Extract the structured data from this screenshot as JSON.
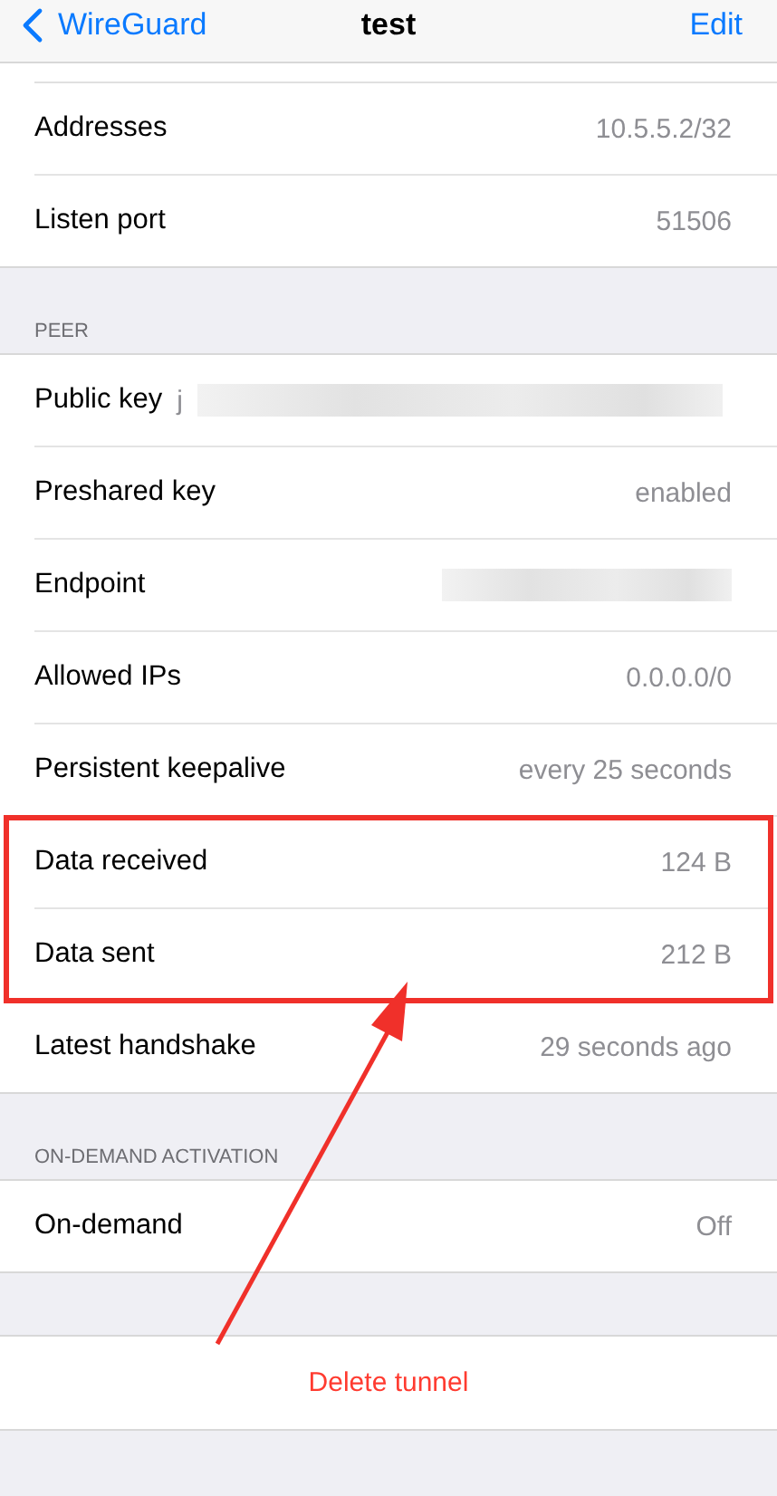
{
  "nav": {
    "back": "WireGuard",
    "title": "test",
    "action": "Edit"
  },
  "interface_rows": [
    {
      "label": "Addresses",
      "kind": "text",
      "value": "10.5.5.2/32",
      "highlighted": false
    },
    {
      "label": "Listen port",
      "kind": "text",
      "value": "51506",
      "highlighted": false
    }
  ],
  "peer": {
    "header": "PEER",
    "rows": [
      {
        "label": "Public key",
        "kind": "redacted",
        "value": "j",
        "highlighted": false
      },
      {
        "label": "Preshared key",
        "kind": "text",
        "value": "enabled",
        "highlighted": false
      },
      {
        "label": "Endpoint",
        "kind": "redacted",
        "highlighted": false
      },
      {
        "label": "Allowed IPs",
        "kind": "text",
        "value": "0.0.0.0/0",
        "highlighted": false
      },
      {
        "label": "Persistent keepalive",
        "kind": "text",
        "value": "every 25 seconds",
        "highlighted": false
      },
      {
        "label": "Data received",
        "kind": "text",
        "value": "124 B",
        "highlighted": true
      },
      {
        "label": "Data sent",
        "kind": "text",
        "value": "212 B",
        "highlighted": true
      },
      {
        "label": "Latest handshake",
        "kind": "text",
        "value": "29 seconds ago",
        "highlighted": false
      }
    ]
  },
  "on_demand": {
    "header": "ON-DEMAND ACTIVATION",
    "rows": [
      {
        "label": "On-demand",
        "kind": "text",
        "value": "Off",
        "highlighted": false
      }
    ]
  },
  "delete_button": "Delete tunnel",
  "annotation": {
    "arrow": true
  }
}
